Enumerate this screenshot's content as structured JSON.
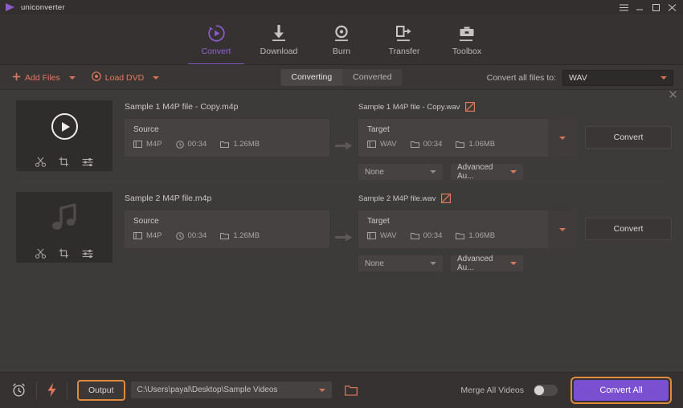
{
  "titlebar": {
    "app_name": "uniconverter",
    "logo_icon": "play-triangle-logo",
    "controls": [
      {
        "name": "menu-icon",
        "glyph": "☰"
      },
      {
        "name": "minimize-icon",
        "glyph": "–"
      },
      {
        "name": "maximize-icon",
        "glyph": "□"
      },
      {
        "name": "close-icon",
        "glyph": "✕"
      }
    ]
  },
  "nav": {
    "tabs": [
      {
        "label": "Convert",
        "icon": "convert-circle-icon",
        "active": true
      },
      {
        "label": "Download",
        "icon": "download-arrow-icon",
        "active": false
      },
      {
        "label": "Burn",
        "icon": "burn-disc-icon",
        "active": false
      },
      {
        "label": "Transfer",
        "icon": "transfer-device-icon",
        "active": false
      },
      {
        "label": "Toolbox",
        "icon": "toolbox-icon",
        "active": false
      }
    ],
    "accent_color": "#8a5ccc"
  },
  "toolbar": {
    "add_files_label": "Add Files",
    "add_files_icon": "plus-icon",
    "load_dvd_label": "Load DVD",
    "load_dvd_icon": "disc-icon",
    "accent_color": "#e2795e",
    "segments": [
      {
        "label": "Converting",
        "active": true
      },
      {
        "label": "Converted",
        "active": false
      }
    ],
    "convert_all_to_label": "Convert all files to:",
    "format_value": "WAV"
  },
  "files": [
    {
      "thumb_icon": "play-button-icon",
      "tools": [
        "trim-scissors-icon",
        "crop-icon",
        "effects-sliders-icon"
      ],
      "source_name": "Sample 1 M4P file - Copy.m4p",
      "source_box_title": "Source",
      "source_format": "M4P",
      "source_duration": "00:34",
      "source_size": "1.26MB",
      "target_name": "Sample 1 M4P file - Copy.wav",
      "target_box_title": "Target",
      "target_format": "WAV",
      "target_duration": "00:34",
      "target_size": "1.06MB",
      "convert_label": "Convert",
      "subtitle_select": "None",
      "audio_select": "Advanced Au..."
    },
    {
      "thumb_icon": "music-note-icon",
      "tools": [
        "trim-scissors-icon",
        "crop-icon",
        "effects-sliders-icon"
      ],
      "source_name": "Sample 2 M4P file.m4p",
      "source_box_title": "Source",
      "source_format": "M4P",
      "source_duration": "00:34",
      "source_size": "1.26MB",
      "target_name": "Sample 2 M4P file.wav",
      "target_box_title": "Target",
      "target_format": "WAV",
      "target_duration": "00:34",
      "target_size": "1.06MB",
      "convert_label": "Convert",
      "subtitle_select": "None",
      "audio_select": "Advanced Au..."
    }
  ],
  "bottombar": {
    "timer_icon": "alarm-clock-icon",
    "speed_icon": "lightning-bolt-icon",
    "output_label": "Output",
    "output_path": "C:\\Users\\payal\\Desktop\\Sample Videos",
    "folder_icon": "open-folder-icon",
    "merge_label": "Merge All Videos",
    "merge_enabled": false,
    "convert_all_label": "Convert All",
    "convert_all_color": "#7a4fd0",
    "highlight_color": "#e08a3c"
  }
}
